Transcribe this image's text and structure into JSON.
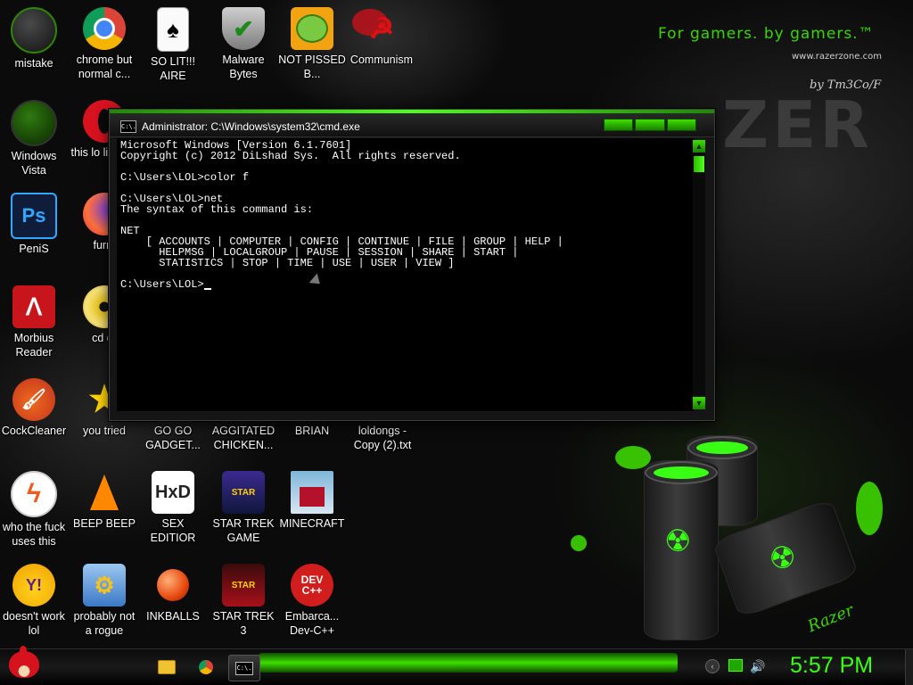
{
  "wallpaper": {
    "tagline": "For gamers. by gamers.™",
    "url": "www.razerzone.com",
    "signature": "by Tm3Co/F",
    "big_logo": "ZER",
    "barrel_logo": "Razer"
  },
  "desktop_icons": [
    {
      "label": "mistake"
    },
    {
      "label": "chrome but normal c..."
    },
    {
      "label": "SO LIT!!! AIRE"
    },
    {
      "label": "Malware Bytes"
    },
    {
      "label": "NOT PISSED B..."
    },
    {
      "label": "Communism"
    },
    {
      "label": "Windows Vista"
    },
    {
      "label": "this lo like a v"
    },
    {
      "label": "PeniS"
    },
    {
      "label": "furry"
    },
    {
      "label": "Morbius Reader"
    },
    {
      "label": "cd dr"
    },
    {
      "label": "CockCleaner"
    },
    {
      "label": "you tried"
    },
    {
      "label": "GO GO GADGET..."
    },
    {
      "label": "AGGITATED CHICKEN..."
    },
    {
      "label": "BRIAN"
    },
    {
      "label": "loldongs - Copy (2).txt"
    },
    {
      "label": "who the fuck uses this"
    },
    {
      "label": "BEEP BEEP"
    },
    {
      "label": "SEX EDITIOR"
    },
    {
      "label": "STAR TREK GAME"
    },
    {
      "label": "MINECRAFT"
    },
    {
      "label": "doesn't work lol"
    },
    {
      "label": "probably not a rogue"
    },
    {
      "label": "INKBALLS"
    },
    {
      "label": "STAR TREK 3"
    },
    {
      "label": "Embarca... Dev-C++"
    }
  ],
  "cmd": {
    "title": "Administrator: C:\\Windows\\system32\\cmd.exe",
    "icon_text": "C:\\.",
    "lines": [
      "Microsoft Windows [Version 6.1.7601]",
      "Copyright (c) 2012 DiLshad Sys.  All rights reserved.",
      "",
      "C:\\Users\\LOL>color f",
      "",
      "C:\\Users\\LOL>net",
      "The syntax of this command is:",
      "",
      "NET",
      "    [ ACCOUNTS | COMPUTER | CONFIG | CONTINUE | FILE | GROUP | HELP |",
      "      HELPMSG | LOCALGROUP | PAUSE | SESSION | SHARE | START |",
      "      STATISTICS | STOP | TIME | USE | USER | VIEW ]",
      "",
      "C:\\Users\\LOL>"
    ],
    "text_color": "#ffffff",
    "background": "#000000"
  },
  "taskbar": {
    "start_icon": "angry-bird-icon",
    "pinned": [
      {
        "name": "explorer-icon"
      },
      {
        "name": "chrome-icon"
      },
      {
        "name": "cmd-icon",
        "active": true
      }
    ],
    "tray": [
      {
        "name": "tray-arrow-icon"
      },
      {
        "name": "network-icon"
      },
      {
        "name": "volume-icon"
      }
    ],
    "clock": "5:57 PM",
    "accent": "#39ff14"
  }
}
